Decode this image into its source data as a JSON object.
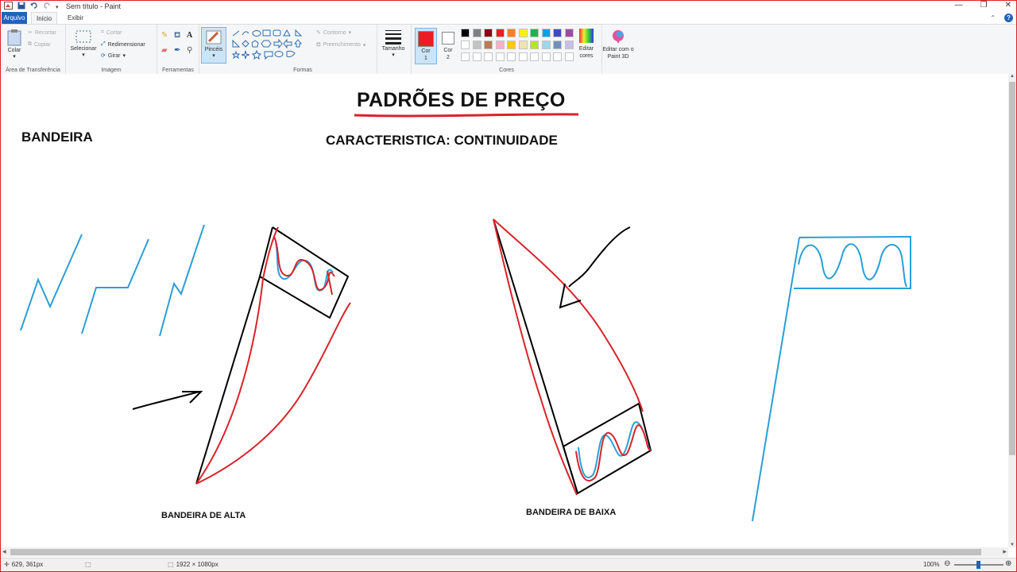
{
  "window": {
    "title": "Sem título - Paint"
  },
  "tabs": [
    {
      "label": "Arquivo"
    },
    {
      "label": "Início"
    },
    {
      "label": "Exibir"
    }
  ],
  "ribbon": {
    "clipboard": {
      "paste": "Colar",
      "cut": "Recortar",
      "copy": "Copiar",
      "group": "Área de Transferência"
    },
    "image": {
      "select": "Selecionar",
      "crop": "Cortar",
      "resize": "Redimensionar",
      "rotate": "Girar",
      "group": "Imagem"
    },
    "tools": {
      "group": "Ferramentas"
    },
    "brushes": {
      "label": "Pincéis"
    },
    "shapes": {
      "outline": "Contorno",
      "fill": "Preenchimento",
      "group": "Formas"
    },
    "size": {
      "label": "Tamanho"
    },
    "colors": {
      "color1": "Cor 1",
      "color2": "Cor 2",
      "edit": "Editar cores",
      "group": "Cores",
      "color1_value": "#ed1c24",
      "color2_value": "#ffffff",
      "palette_row1": [
        "#000000",
        "#7f7f7f",
        "#880015",
        "#ed1c24",
        "#ff7f27",
        "#fff200",
        "#22b14c",
        "#00a2e8",
        "#3f48cc",
        "#a349a4"
      ],
      "palette_row2": [
        "#ffffff",
        "#c3c3c3",
        "#b97a57",
        "#ffaec9",
        "#ffc90e",
        "#efe4b0",
        "#b5e61d",
        "#99d9ea",
        "#7092be",
        "#c8bfe7"
      ]
    },
    "paint3d": {
      "label": "Editar com o Paint 3D"
    }
  },
  "canvas": {
    "heading": "PADRÕES DE PREÇO",
    "subheading": "CARACTERISTICA: CONTINUIDADE",
    "section": "BANDEIRA",
    "caption_bull": "BANDEIRA DE ALTA",
    "caption_bear": "BANDEIRA DE BAIXA"
  },
  "status": {
    "cursor": "629, 361px",
    "image_size": "1922 × 1080px",
    "zoom": "100%"
  }
}
